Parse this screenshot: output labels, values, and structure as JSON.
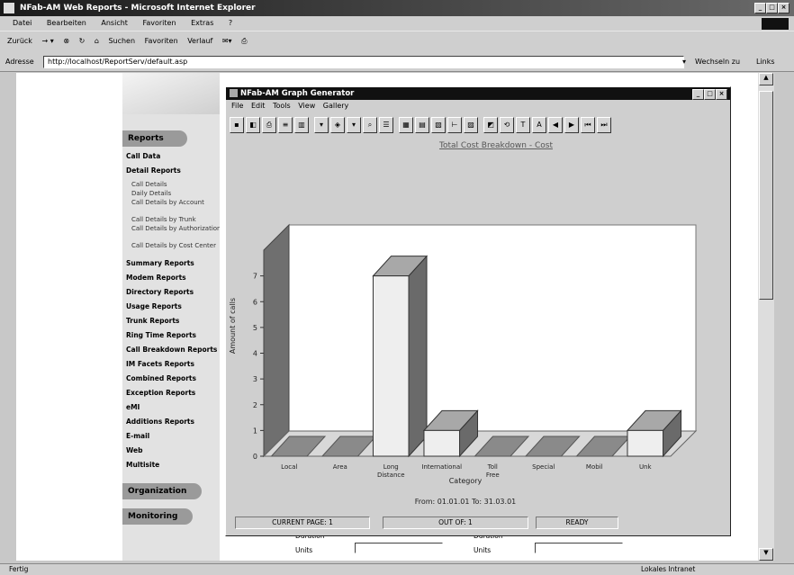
{
  "window": {
    "title": "NFab-AM Web Reports - Microsoft Internet Explorer"
  },
  "menubar": [
    "Datei",
    "Bearbeiten",
    "Ansicht",
    "Favoriten",
    "Extras",
    "?"
  ],
  "toolbar": {
    "back": "Zurück",
    "search": "Suchen",
    "favorites": "Favoriten",
    "media": "Verlauf"
  },
  "address": {
    "label": "Adresse",
    "url": "http://localhost/ReportServ/default.asp",
    "go": "Wechseln zu",
    "links": "Links"
  },
  "nav": {
    "reports_heading": "Reports",
    "items": [
      {
        "label": "Call Data",
        "sub": false
      },
      {
        "label": "Detail Reports",
        "sub": false
      },
      {
        "label": "Call Details",
        "sub": true
      },
      {
        "label": "Daily Details",
        "sub": true
      },
      {
        "label": "Call Details by Account",
        "sub": true
      },
      {
        "label": "Call Details by Trunk",
        "sub": true
      },
      {
        "label": "Call Details by Authorization",
        "sub": true
      },
      {
        "label": "Call Details by Cost Center",
        "sub": true
      },
      {
        "label": "Summary Reports",
        "sub": false
      },
      {
        "label": "Modem Reports",
        "sub": false
      },
      {
        "label": "Directory Reports",
        "sub": false
      },
      {
        "label": "Usage Reports",
        "sub": false
      },
      {
        "label": "Trunk Reports",
        "sub": false
      },
      {
        "label": "Ring Time Reports",
        "sub": false
      },
      {
        "label": "Call Breakdown Reports",
        "sub": false
      },
      {
        "label": "IM Facets Reports",
        "sub": false
      },
      {
        "label": "Combined Reports",
        "sub": false
      },
      {
        "label": "Exception Reports",
        "sub": false
      },
      {
        "label": "eMI",
        "sub": false
      },
      {
        "label": "Additions Reports",
        "sub": false
      },
      {
        "label": "E-mail",
        "sub": false
      },
      {
        "label": "Web",
        "sub": false
      },
      {
        "label": "Multisite",
        "sub": false
      }
    ],
    "organization": "Organization",
    "monitoring": "Monitoring"
  },
  "dialog": {
    "title": "NFab-AM Graph Generator",
    "menu": [
      "File",
      "Edit",
      "Tools",
      "View",
      "Gallery"
    ],
    "footer_range": "From: 01.01.01     To: 31.03.01",
    "status": {
      "page": "CURRENT PAGE: 1",
      "of": "OUT OF: 1",
      "ready": "READY"
    }
  },
  "under_dialog": {
    "duration": "Duration",
    "units": "Units"
  },
  "statusbar": {
    "left": "Fertig",
    "right": "Lokales Intranet"
  },
  "chart_data": {
    "type": "bar",
    "title": "Total Cost Breakdown - Cost",
    "xlabel": "Category",
    "ylabel": "Amount of calls",
    "ylim": [
      0,
      8
    ],
    "yticks": [
      0,
      1,
      2,
      3,
      4,
      5,
      6,
      7
    ],
    "categories": [
      "Local",
      "Area",
      "Long Distance",
      "International",
      "Toll Free",
      "Special",
      "Mobil",
      "Unk"
    ],
    "values": [
      0,
      0,
      7,
      1,
      0,
      0,
      0,
      1
    ],
    "grid": false,
    "style": "3d"
  }
}
